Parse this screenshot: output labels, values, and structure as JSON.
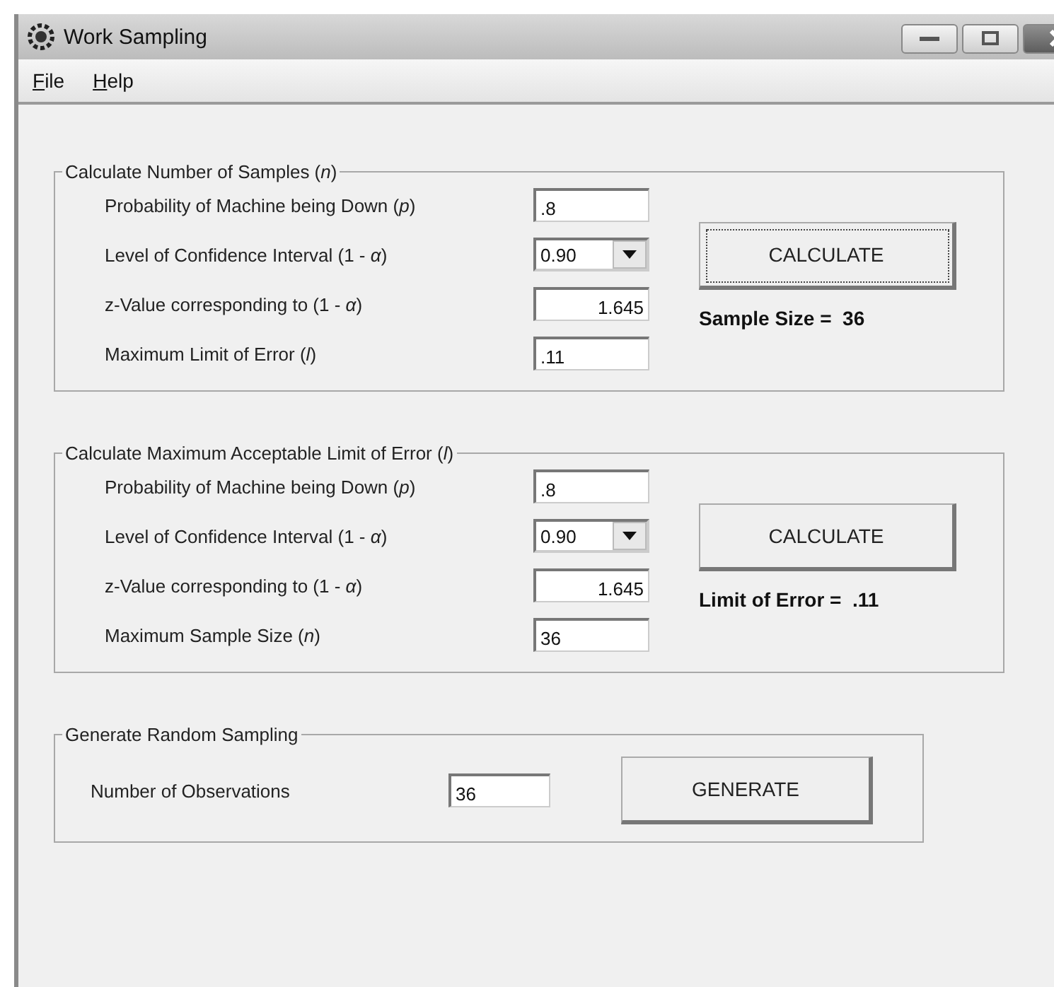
{
  "window": {
    "title": "Work Sampling"
  },
  "menu": [
    {
      "label": "File",
      "access_key": true
    },
    {
      "label": "Help",
      "access_key": true
    }
  ],
  "groups": [
    {
      "title": "Calculate Number of Samples (*n*)",
      "rows": [
        {
          "label": "Probability of Machine being Down (*p*)",
          "kind": "text",
          "value": ".8"
        },
        {
          "label": "Level of Confidence Interval  (1 - *α*)",
          "kind": "dropdown",
          "value": "0.90"
        },
        {
          "label": "z-Value corresponding to (1 - *α*)",
          "kind": "number",
          "value": "1.645"
        },
        {
          "label": "Maximum Limit of Error (*l*)",
          "kind": "text",
          "value": ".11"
        }
      ],
      "button": {
        "label": "CALCULATE",
        "focused": true
      },
      "result": "Sample Size =  36"
    },
    {
      "title": "Calculate Maximum Acceptable Limit of Error (*l*)",
      "rows": [
        {
          "label": "Probability of Machine being Down (*p*)",
          "kind": "text",
          "value": ".8"
        },
        {
          "label": "Level of Confidence Interval  (1 - *α*)",
          "kind": "dropdown",
          "value": "0.90"
        },
        {
          "label": "z-Value corresponding to  (1 - *α*)",
          "kind": "number",
          "value": "1.645"
        },
        {
          "label": "Maximum Sample Size (*n*)",
          "kind": "text",
          "value": "36"
        }
      ],
      "button": {
        "label": "CALCULATE",
        "focused": false
      },
      "result": "Limit of Error =  .11"
    }
  ],
  "random_sampling": {
    "title": "Generate Random Sampling",
    "label": "Number of Observations",
    "value": "36",
    "button": {
      "label": "GENERATE",
      "focused": false
    }
  }
}
